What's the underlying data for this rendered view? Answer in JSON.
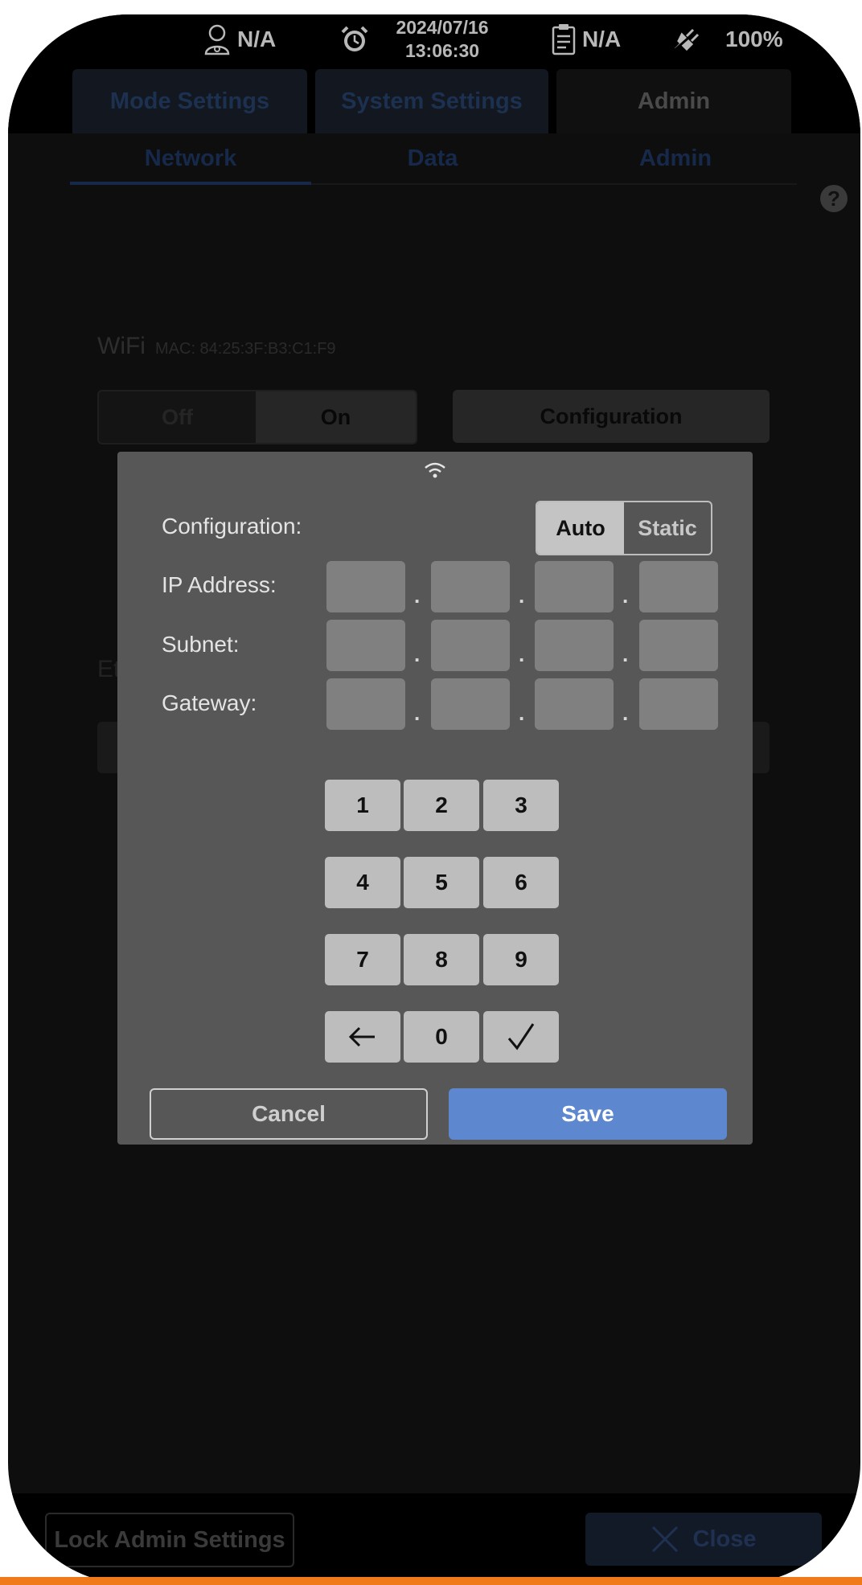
{
  "status": {
    "user": "N/A",
    "date": "2024/07/16",
    "time": "13:06:30",
    "clipboard": "N/A",
    "battery": "100%"
  },
  "main_tabs": [
    {
      "label": "Mode Settings",
      "active": false
    },
    {
      "label": "System Settings",
      "active": false
    },
    {
      "label": "Admin",
      "active": true
    }
  ],
  "sub_tabs": [
    {
      "label": "Network",
      "active": true
    },
    {
      "label": "Data",
      "active": false
    },
    {
      "label": "Admin",
      "active": false
    }
  ],
  "network": {
    "wifi_label": "WiFi",
    "mac": "MAC:  84:25:3F:B3:C1:F9",
    "off": "Off",
    "on": "On",
    "configuration": "Configuration",
    "ethernet_label": "Et"
  },
  "dialog": {
    "configuration_label": "Configuration:",
    "auto": "Auto",
    "static": "Static",
    "selected_mode": "Auto",
    "ip_label": "IP Address:",
    "subnet_label": "Subnet:",
    "gateway_label": "Gateway:",
    "ip_values": [
      "",
      "",
      "",
      ""
    ],
    "subnet_values": [
      "",
      "",
      "",
      ""
    ],
    "gateway_values": [
      "",
      "",
      "",
      ""
    ],
    "keypad": [
      "1",
      "2",
      "3",
      "4",
      "5",
      "6",
      "7",
      "8",
      "9",
      "back-arrow-icon",
      "0",
      "checkmark-icon"
    ],
    "cancel": "Cancel",
    "save": "Save"
  },
  "bottom": {
    "lock": "Lock Admin Settings",
    "close": "Close"
  },
  "colors": {
    "accent": "#5d87cf",
    "orange": "#f07a1a"
  }
}
